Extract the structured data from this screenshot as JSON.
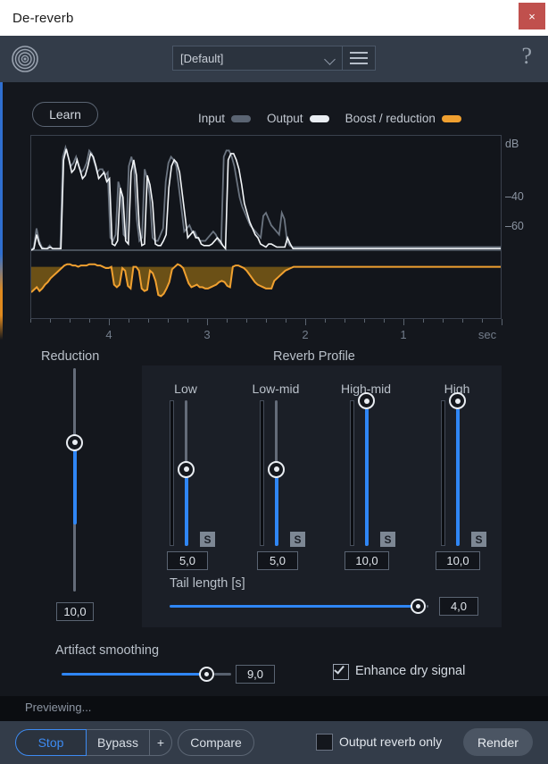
{
  "window": {
    "title": "De-reverb",
    "close_label": "×"
  },
  "header": {
    "brand_icon": "concentric-circles-icon",
    "preset_value": "[Default]",
    "preset_menu_icon": "hamburger-menu-icon",
    "help_label": "?"
  },
  "toolbar": {
    "learn_label": "Learn"
  },
  "legend": [
    {
      "label": "Input",
      "color": "#5a6472"
    },
    {
      "label": "Output",
      "color": "#e9edf2"
    },
    {
      "label": "Boost / reduction",
      "color": "#f0a030"
    }
  ],
  "chart_data": {
    "type": "line",
    "title": "",
    "xlabel": "sec",
    "ylabel": "dB",
    "y_tick_labels": [
      "dB",
      "40",
      "60"
    ],
    "x_tick_labels": [
      "4",
      "3",
      "2",
      "1",
      "sec"
    ],
    "x_tick_positions": [
      4,
      3,
      2,
      1,
      0
    ],
    "xlim": [
      4.8,
      0
    ],
    "grid": false,
    "legend_position": "top",
    "series": [
      {
        "name": "Input",
        "color": "#6b7480",
        "points": [
          0,
          2,
          14,
          6,
          2,
          1,
          1,
          3,
          1,
          1,
          1,
          1,
          60,
          66,
          60,
          54,
          56,
          60,
          54,
          50,
          52,
          56,
          64,
          62,
          56,
          50,
          52,
          52,
          48,
          50,
          8,
          6,
          10,
          44,
          38,
          10,
          8,
          54,
          60,
          52,
          20,
          6,
          8,
          52,
          46,
          34,
          8,
          6,
          6,
          10,
          14,
          44,
          56,
          60,
          58,
          54,
          40,
          26,
          12,
          14,
          16,
          12,
          12,
          8,
          6,
          6,
          6,
          8,
          10,
          12,
          10,
          6,
          4,
          60,
          64,
          64,
          60,
          54,
          44,
          34,
          28,
          24,
          20,
          16,
          14,
          12,
          10,
          8,
          22,
          24,
          20,
          16,
          14,
          12,
          10,
          24,
          20,
          6,
          3,
          2,
          2,
          2,
          2,
          2,
          2,
          2,
          2,
          2,
          2,
          2,
          2,
          2,
          2,
          2,
          2,
          2,
          2,
          2,
          2,
          2,
          2,
          2,
          2,
          2,
          2,
          2,
          2,
          2,
          2,
          2,
          2,
          2,
          2,
          2,
          2,
          2,
          2,
          2,
          2,
          2,
          2,
          2,
          2,
          2,
          2,
          2,
          2,
          2,
          2,
          2,
          2,
          2,
          2,
          2,
          2,
          2,
          2,
          2,
          2,
          2,
          2,
          2,
          2,
          2,
          2,
          2,
          2,
          2,
          2,
          2,
          2,
          2,
          2,
          2,
          2,
          2,
          2,
          2,
          2
        ]
      },
      {
        "name": "Output",
        "color": "#f2f5f8",
        "points": [
          0,
          1,
          10,
          4,
          1,
          1,
          1,
          2,
          1,
          1,
          1,
          1,
          58,
          65,
          58,
          50,
          52,
          58,
          52,
          46,
          48,
          54,
          62,
          60,
          54,
          46,
          48,
          50,
          44,
          46,
          4,
          3,
          6,
          40,
          34,
          6,
          4,
          50,
          58,
          48,
          16,
          3,
          4,
          48,
          42,
          30,
          4,
          3,
          3,
          6,
          10,
          40,
          54,
          58,
          56,
          50,
          36,
          22,
          8,
          10,
          12,
          8,
          8,
          4,
          3,
          3,
          3,
          4,
          6,
          8,
          6,
          3,
          1,
          58,
          62,
          62,
          58,
          52,
          42,
          30,
          24,
          18,
          14,
          10,
          8,
          4,
          3,
          2,
          4,
          4,
          3,
          2,
          2,
          2,
          2,
          8,
          4,
          1,
          1,
          1,
          1,
          1,
          1,
          1,
          1,
          1,
          1,
          1,
          1,
          1,
          1,
          1,
          1,
          1,
          1,
          1,
          1,
          1,
          1,
          1,
          1,
          1,
          1,
          1,
          1,
          1,
          1,
          1,
          1,
          1,
          1,
          1,
          1,
          1,
          1,
          1,
          1,
          1,
          1,
          1,
          1,
          1,
          1,
          1,
          1,
          1,
          1,
          1,
          1,
          1,
          1,
          1,
          1,
          1,
          1,
          1,
          1,
          1,
          1,
          1,
          1,
          1,
          1,
          1,
          1,
          1,
          1,
          1,
          1,
          1,
          1,
          1,
          1,
          1,
          1
        ]
      },
      {
        "name": "Boost / reduction",
        "color": "#f0a030",
        "points": [
          18,
          22,
          26,
          20,
          24,
          30,
          34,
          40,
          44,
          48,
          52,
          56,
          60,
          62,
          62,
          60,
          60,
          58,
          60,
          60,
          60,
          62,
          62,
          62,
          60,
          60,
          58,
          56,
          56,
          58,
          30,
          26,
          30,
          56,
          52,
          28,
          24,
          58,
          58,
          52,
          24,
          20,
          22,
          52,
          48,
          36,
          14,
          12,
          16,
          24,
          34,
          54,
          58,
          62,
          60,
          56,
          44,
          32,
          26,
          28,
          30,
          26,
          26,
          24,
          24,
          26,
          28,
          30,
          34,
          36,
          34,
          28,
          26,
          58,
          60,
          60,
          58,
          56,
          52,
          46,
          40,
          34,
          30,
          28,
          26,
          24,
          24,
          24,
          36,
          40,
          44,
          48,
          52,
          54,
          56,
          58,
          58,
          58,
          58,
          58,
          58,
          58,
          58,
          58,
          58,
          58,
          58,
          58,
          58,
          58,
          58,
          58,
          58,
          58,
          58,
          58,
          58,
          58,
          58,
          58,
          58,
          58,
          58,
          58,
          58,
          58,
          58,
          58,
          58,
          58,
          58,
          58,
          58,
          58,
          58,
          58,
          58,
          58,
          58,
          58,
          58,
          58,
          58,
          58,
          58,
          58,
          58,
          58,
          58,
          58,
          58,
          58,
          58,
          58,
          58,
          58,
          58,
          58,
          58,
          58,
          58,
          58,
          58,
          58,
          58,
          58,
          58,
          58,
          58,
          58,
          58
        ]
      }
    ]
  },
  "reduction": {
    "label": "Reduction",
    "value": "10,0",
    "knob_percent": 33
  },
  "reverb_profile": {
    "label": "Reverb Profile",
    "bands": [
      {
        "label": "Low",
        "value": "5,0",
        "knob_percent": 47,
        "solo_label": "S",
        "solo_active": false
      },
      {
        "label": "Low-mid",
        "value": "5,0",
        "knob_percent": 47,
        "solo_label": "S",
        "solo_active": false
      },
      {
        "label": "High-mid",
        "value": "10,0",
        "knob_percent": 0,
        "solo_label": "S",
        "solo_active": false
      },
      {
        "label": "High",
        "value": "10,0",
        "knob_percent": 0,
        "solo_label": "S",
        "solo_active": false
      }
    ],
    "tail_length": {
      "label": "Tail length [s]",
      "value": "4,0",
      "percent": 96
    }
  },
  "artifact_smoothing": {
    "label": "Artifact smoothing",
    "value": "9,0",
    "percent": 90
  },
  "enhance_dry_signal": {
    "label": "Enhance dry signal",
    "checked": true
  },
  "status": {
    "text": "Previewing..."
  },
  "transport": {
    "stop_label": "Stop",
    "bypass_label": "Bypass",
    "plus_label": "+",
    "compare_label": "Compare",
    "output_reverb_only_label": "Output reverb only",
    "output_reverb_only_checked": false,
    "render_label": "Render"
  },
  "colors": {
    "accent_blue": "#2f86f5",
    "accent_orange": "#f0a030",
    "panel": "#1b1f27",
    "background": "#14171d",
    "header": "#333c49",
    "close_red": "#c0504d"
  }
}
